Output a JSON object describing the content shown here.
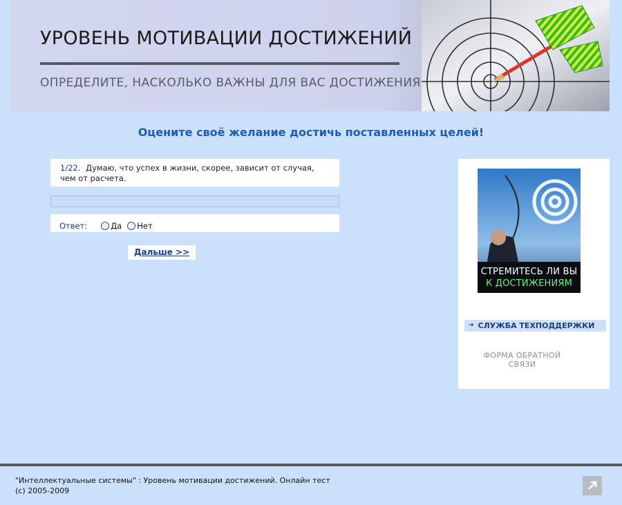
{
  "banner": {
    "title": "УРОВЕНЬ МОТИВАЦИИ ДОСТИЖЕНИЙ",
    "subtitle": "ОПРЕДЕЛИТЕ, НАСКОЛЬКО ВАЖНЫ ДЛЯ ВАС ДОСТИЖЕНИЯ"
  },
  "headline": "Оцените своё желание достичь поставленных целей!",
  "question": {
    "number": "1/22.",
    "text": "Думаю, что успех в жизни, скорее, зависит от случая, чем от расчета."
  },
  "answer": {
    "label": "Ответ:",
    "options": [
      "Да",
      "Нет"
    ]
  },
  "next_label": "Дальше >>",
  "sidebar": {
    "promo_line1": "СТРЕМИТЕСЬ ЛИ ВЫ",
    "promo_line2": "К ДОСТИЖЕНИЯМ",
    "support_label": "СЛУЖБА ТЕХПОДДЕРЖКИ",
    "feedback_label": "ФОРМА ОБРАТНОЙ СВЯЗИ"
  },
  "footer": {
    "line1": "\"Интеллектуальные системы\" : Уровень мотивации достижений. Онлайн тест",
    "line2": "(c) 2005-2009"
  },
  "colors": {
    "page_background": "#cbe0fb",
    "headline": "#1f5bb8",
    "link": "#1a3f8a",
    "promo_green": "#6ef07a"
  },
  "icons": {
    "banner_art": "target-dart-icon",
    "support_arrow": "arrow-right-icon",
    "scroll_top": "arrow-up-right-icon"
  }
}
